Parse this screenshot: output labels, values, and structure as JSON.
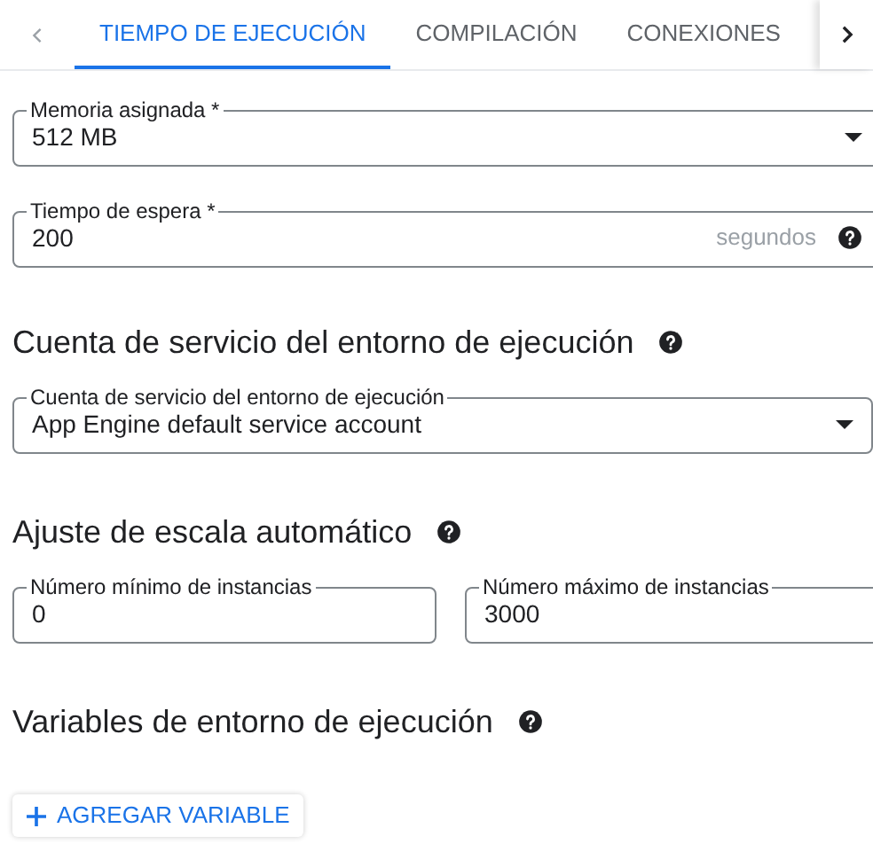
{
  "tabs": [
    {
      "label": "TIEMPO DE EJECUCIÓN",
      "selected": true
    },
    {
      "label": "COMPILACIÓN",
      "selected": false
    },
    {
      "label": "CONEXIONES",
      "selected": false
    }
  ],
  "top_fields": [
    {
      "kind": "select",
      "label": "Memoria asignada *",
      "value": "512 MB"
    },
    {
      "kind": "text",
      "label": "Tiempo de espera *",
      "value": "200",
      "suffix": "segundos",
      "help": true
    }
  ],
  "sections": [
    {
      "heading": "Cuenta de servicio del entorno de ejecución",
      "fields": [
        {
          "kind": "select",
          "label": "Cuenta de servicio del entorno de ejecución",
          "value": "App Engine default service account"
        }
      ]
    },
    {
      "heading": "Ajuste de escala automático",
      "fields": [
        {
          "kind": "text",
          "label": "Número mínimo de instancias",
          "value": "0"
        },
        {
          "kind": "text",
          "label": "Número máximo de instancias",
          "value": "3000"
        }
      ]
    },
    {
      "heading": "Variables de entorno de ejecución"
    }
  ],
  "add_button": {
    "label": "AGREGAR VARIABLE"
  }
}
